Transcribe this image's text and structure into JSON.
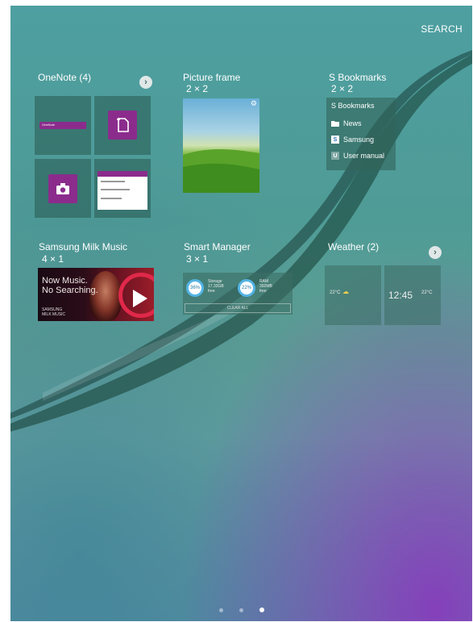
{
  "header": {
    "search_label": "SEARCH"
  },
  "widgets": {
    "onenote": {
      "label": "OneNote (4)",
      "arrow": "›",
      "mini_title": "OneNote"
    },
    "picture_frame": {
      "label": "Picture frame",
      "size": "2 × 2"
    },
    "s_bookmarks": {
      "label": "S Bookmarks",
      "size": "2 × 2",
      "title": "S Bookmarks",
      "items": [
        {
          "label": "News",
          "icon": "folder-icon"
        },
        {
          "label": "Samsung",
          "icon": "samsung-s-icon"
        },
        {
          "label": "User manual",
          "icon": "manual-icon"
        }
      ]
    },
    "milk_music": {
      "label": "Samsung Milk Music",
      "size": "4 × 1",
      "line1": "Now Music.",
      "line2": "No Searching.",
      "brand_top": "SAMSUNG",
      "brand": "MILK MUSIC"
    },
    "smart_manager": {
      "label": "Smart Manager",
      "size": "3 × 1",
      "storage_pct": "36%",
      "storage_label": "Storage",
      "storage_value": "17.33GB",
      "storage_free": "free",
      "ram_pct": "22%",
      "ram_label": "RAM",
      "ram_value": "392MB",
      "ram_free": "free",
      "clear_label": "CLEAR ALL"
    },
    "weather": {
      "label": "Weather (2)",
      "arrow": "›",
      "temp1": "22°C",
      "time": "12:45",
      "temp2": "22°C"
    }
  },
  "pager": {
    "page_count": 3,
    "active_index": 2
  },
  "colors": {
    "onenote_purple": "#8b2c8c",
    "ring_blue": "#54b4e4"
  }
}
